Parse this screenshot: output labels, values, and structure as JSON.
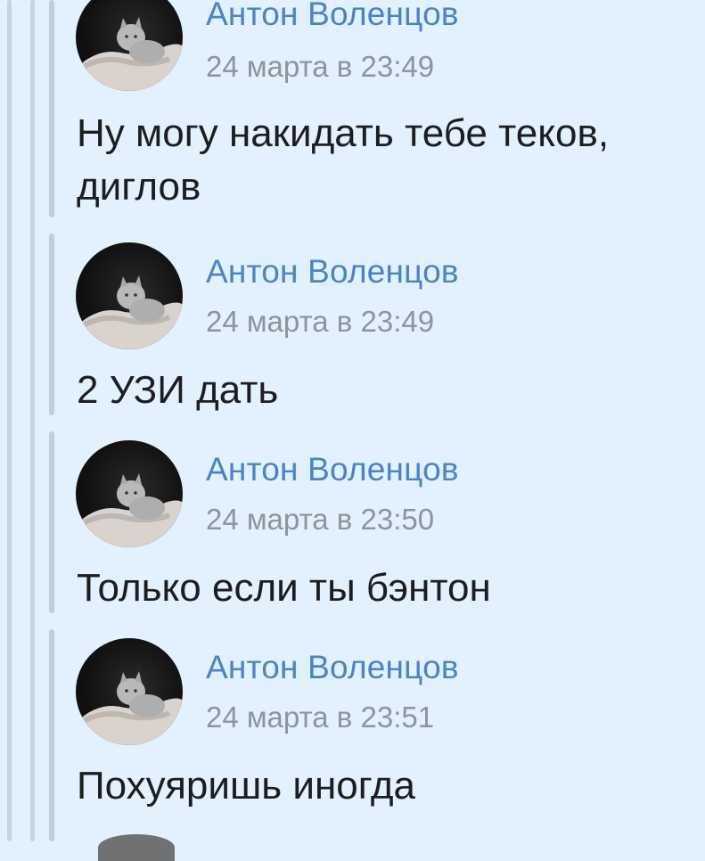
{
  "messages": [
    {
      "author": "Антон Воленцов",
      "time": "24 марта в 23:49",
      "text": "Ну могу накидать тебе теков, диглов"
    },
    {
      "author": "Антон Воленцов",
      "time": "24 марта в 23:49",
      "text": "2 УЗИ дать"
    },
    {
      "author": "Антон Воленцов",
      "time": "24 марта в 23:50",
      "text": "Только если ты бэнтон"
    },
    {
      "author": "Антон Воленцов",
      "time": "24 марта в 23:51",
      "text": "Похуяришь иногда"
    }
  ],
  "colors": {
    "background": "#e2f1fd",
    "author": "#4a84c6",
    "time": "#8d949b",
    "text": "#1d1d1f",
    "thread_line": "#c3d4e3"
  },
  "icons": {
    "avatar": "kitten-in-hands-photo"
  }
}
